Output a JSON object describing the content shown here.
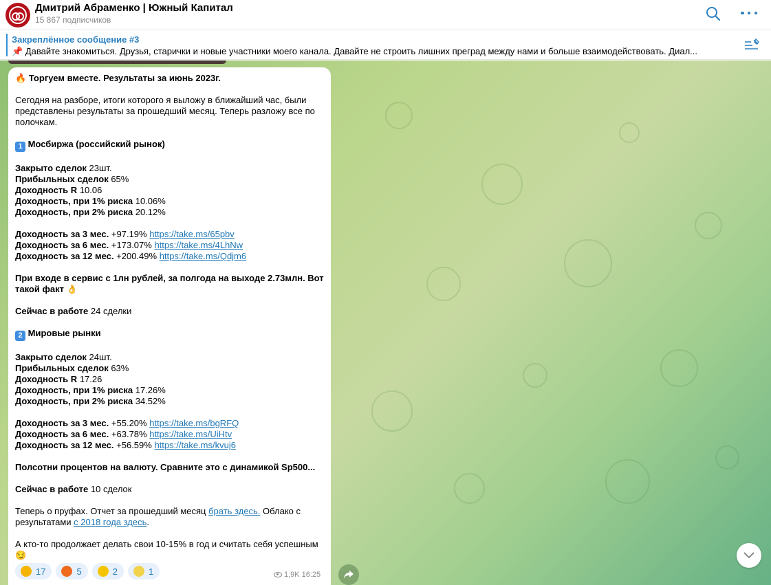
{
  "header": {
    "title": "Дмитрий Абраменко | Южный Капитал",
    "subscribers": "15 867 подписчиков"
  },
  "pinned": {
    "title": "Закреплённое сообщение #3",
    "text": "📌 Давайте знакомиться.  Друзья, старички и новые участники моего канала. Давайте не строить лишних преград между нами и больше взаимодействовать. Диал..."
  },
  "message": {
    "heading_emoji": "🔥",
    "heading": "Торгуем вместе. Результаты за июнь 2023г.",
    "intro": "Сегодня на разборе, итоги которого я выложу в ближайший час, были представлены результаты за прошедший месяц. Теперь разложу все по полочкам.",
    "s1_num": "1",
    "s1_title": "Мосбиржа (российский рынок)",
    "s1": {
      "deals_label": "Закрыто сделок",
      "deals_value": "23шт.",
      "profit_label": "Прибыльных сделок",
      "profit_value": "65%",
      "yield_label": "Доходность R",
      "yield_value": "10.06",
      "y1_label": "Доходность, при 1% риска",
      "y1_value": "10.06%",
      "y2_label": "Доходность, при 2% риска",
      "y2_value": "20.12%",
      "m3_label": "Доходность за 3 мес.",
      "m3_value": "+97.19%",
      "m3_link": "https://take.ms/65pbv",
      "m6_label": "Доходность за 6 мес.",
      "m6_value": "+173.07%",
      "m6_link": "https://take.ms/4LhNw",
      "m12_label": "Доходность за 12 мес.",
      "m12_value": "+200.49%",
      "m12_link": "https://take.ms/Qdjm6"
    },
    "s1_fact": "При входе в сервис с 1лн рублей, за полгода на выходе 2.73млн. Вот такой факт 👌",
    "s1_work_label": "Сейчас в работе",
    "s1_work_value": "24 сделки",
    "s2_num": "2",
    "s2_title": "Мировые рынки",
    "s2": {
      "deals_label": "Закрыто сделок",
      "deals_value": "24шт.",
      "profit_label": "Прибыльных сделок",
      "profit_value": "63%",
      "yield_label": "Доходность R",
      "yield_value": "17.26",
      "y1_label": "Доходность, при 1% риска",
      "y1_value": "17.26%",
      "y2_label": "Доходность, при 2% риска",
      "y2_value": "34.52%",
      "m3_label": "Доходность за 3 мес.",
      "m3_value": "+55.20% ",
      "m3_link": "https://take.ms/bgRFQ",
      "m6_label": "Доходность за 6 мес.",
      "m6_value": "+63.78%",
      "m6_link": "https://take.ms/UiHtv",
      "m12_label": "Доходность за 12 мес.",
      "m12_value": "+56.59%",
      "m12_link": "https://take.ms/kvuj6"
    },
    "s2_note": "Полсотни процентов на валюту. Сравните это с динамикой Sp500...",
    "s2_work_label": "Сейчас в работе",
    "s2_work_value": "10 сделок",
    "proof_pre": "Теперь о пруфах. Отчет за прошедший месяц ",
    "proof_link1": "брать здесь.",
    "proof_mid": " Облако с результатами ",
    "proof_link2": "с 2018 года здесь",
    "proof_end": ".",
    "outro": "А кто-то продолжает делать свои 10-15% в год и считать себя успешным 😏",
    "views": "1,9K",
    "time": "16:25"
  },
  "reactions": [
    {
      "emoji": "thumbs-up",
      "count": "17",
      "color": "#f5b400"
    },
    {
      "emoji": "fire",
      "count": "5",
      "color": "#f06a1e"
    },
    {
      "emoji": "grinning",
      "count": "2",
      "color": "#f5c400"
    },
    {
      "emoji": "banana",
      "count": "1",
      "color": "#f2d34c"
    }
  ]
}
